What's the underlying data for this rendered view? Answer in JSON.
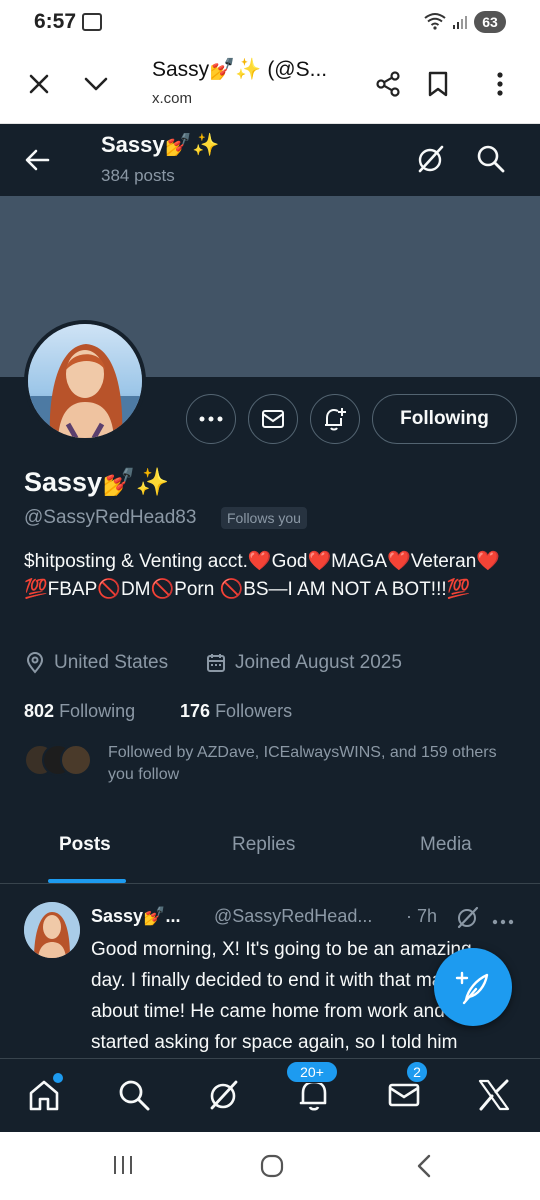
{
  "status_bar": {
    "time": "6:57",
    "battery": "63"
  },
  "browser": {
    "title": "Sassy💅✨ (@S...",
    "url": "x.com",
    "icons": [
      "close-icon",
      "chevron-down-icon",
      "share-icon",
      "bookmark-icon",
      "more-vertical-icon"
    ]
  },
  "header": {
    "name": "Sassy💅✨",
    "post_count": "384 posts"
  },
  "profile": {
    "display_name": "Sassy💅✨",
    "handle": "@SassyRedHead83",
    "follows_you": "Follows you",
    "bio": "$hitposting & Venting acct.❤️God❤️MAGA❤️Veteran❤️💯FBAP🚫DM🚫Porn 🚫BS—I AM NOT A BOT!!!💯",
    "location": "United States",
    "joined": "Joined August 2025",
    "following_count": "802",
    "following_label": "Following",
    "followers_count": "176",
    "followers_label": "Followers",
    "followed_by": "Followed by AZDave, ICEalwaysWINS, and 159 others you follow",
    "following_button": "Following"
  },
  "tabs": [
    {
      "label": "Posts",
      "active": true
    },
    {
      "label": "Replies",
      "active": false
    },
    {
      "label": "Media",
      "active": false
    }
  ],
  "post": {
    "name": "Sassy💅...",
    "handle": "@SassyRedHead...",
    "time": "· 7h",
    "text": "Good morning, X! It's going to be an amazing day. I finally decided to end it with that man. It's about time! He came home from work and started asking for space again, so I told him that after a week"
  },
  "bottom_nav": {
    "notifications_badge": "20+",
    "messages_badge": "2"
  },
  "colors": {
    "background": "#15202b",
    "accent": "#1d9bf0",
    "banner": "#425466",
    "muted": "#8b98a5"
  }
}
